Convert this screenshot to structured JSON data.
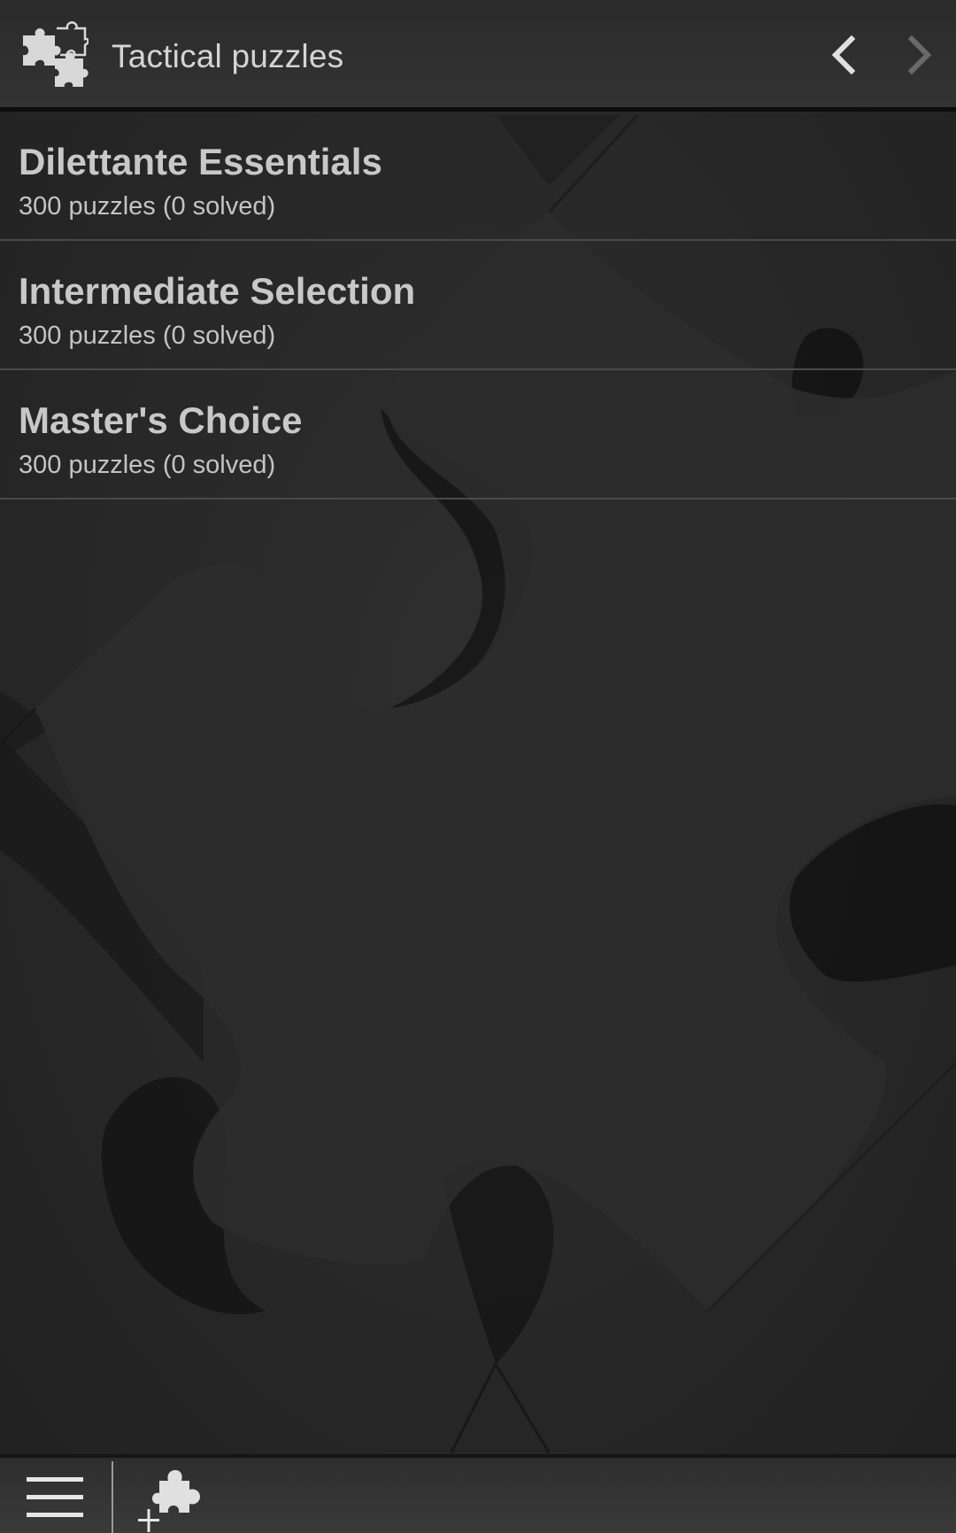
{
  "header": {
    "title": "Tactical puzzles",
    "logo_icon": "puzzle-pieces-icon",
    "back_icon": "chevron-left-icon",
    "forward_icon": "chevron-right-icon"
  },
  "collections": [
    {
      "title": "Dilettante Essentials",
      "subtitle": "300 puzzles (0 solved)"
    },
    {
      "title": "Intermediate Selection",
      "subtitle": "300 puzzles (0 solved)"
    },
    {
      "title": "Master's Choice",
      "subtitle": "300 puzzles (0 solved)"
    }
  ],
  "toolbar": {
    "menu_icon": "hamburger-menu-icon",
    "add_icon": "add-puzzle-icon"
  },
  "colors": {
    "background": "#252525",
    "text_primary": "#c8c8c8",
    "header_text": "#d4d4d4",
    "icon_active": "#e0e0e0",
    "icon_disabled": "#6a6a6a",
    "divider": "#4a4a4a"
  }
}
